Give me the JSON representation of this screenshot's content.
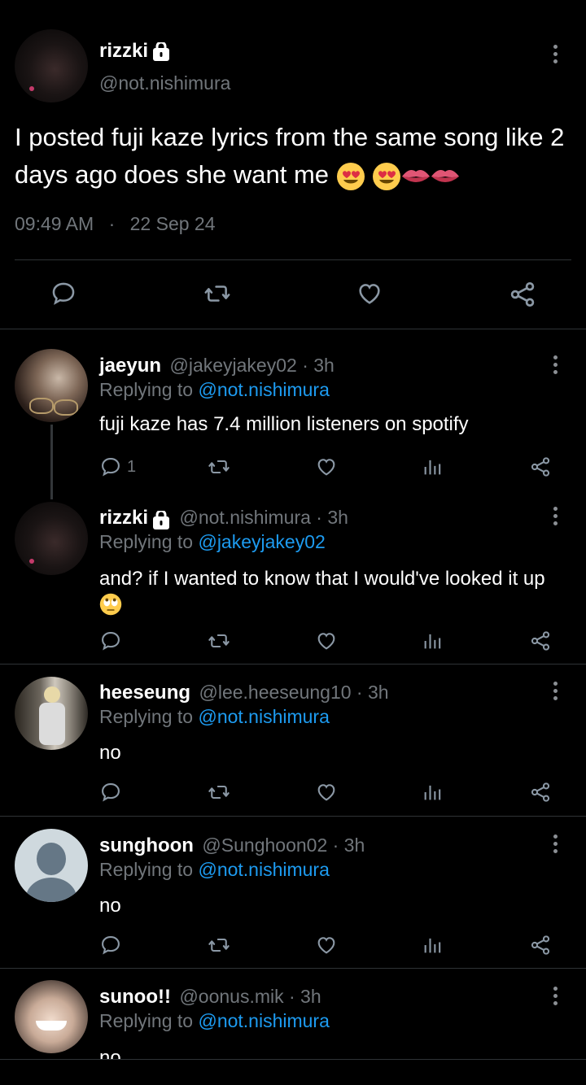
{
  "main_tweet": {
    "name": "rizzki",
    "handle": "@not.nishimura",
    "text": "I posted fuji kaze lyrics from the same song like 2 days ago does she want me",
    "emojis": [
      "heart-eyes-emoji",
      "heart-eyes-emoji",
      "lips-emoji",
      "lips-emoji"
    ],
    "time": "09:49 AM",
    "sep": "·",
    "date": "22 Sep 24"
  },
  "replies": [
    {
      "name": "jaeyun",
      "handle": "@jakeyjakey02 · 3h",
      "replying_label": "Replying to",
      "replying_to": "@not.nishimura",
      "text": "fuji kaze has 7.4 million listeners on spotify",
      "reply_count": "1"
    },
    {
      "name": "rizzki",
      "handle": "@not.nishimura · 3h",
      "replying_label": "Replying to",
      "replying_to": "@jakeyjakey02",
      "text": "and? if I wanted to know that I would've looked it up",
      "emoji": "rolling-eyes-emoji"
    },
    {
      "name": "heeseung",
      "handle": "@lee.heeseung10 · 3h",
      "replying_label": "Replying to",
      "replying_to": "@not.nishimura",
      "text": "no"
    },
    {
      "name": "sunghoon",
      "handle": "@Sunghoon02 · 3h",
      "replying_label": "Replying to",
      "replying_to": "@not.nishimura",
      "text": "no"
    },
    {
      "name": "sunoo!!",
      "handle": "@oonus.mik · 3h",
      "replying_label": "Replying to",
      "replying_to": "@not.nishimura",
      "text": "no"
    }
  ],
  "colors": {
    "background": "#000000",
    "link": "#1d9bf0",
    "muted": "#71767b",
    "divider": "#2f3336",
    "icon": "#8b98a5"
  }
}
